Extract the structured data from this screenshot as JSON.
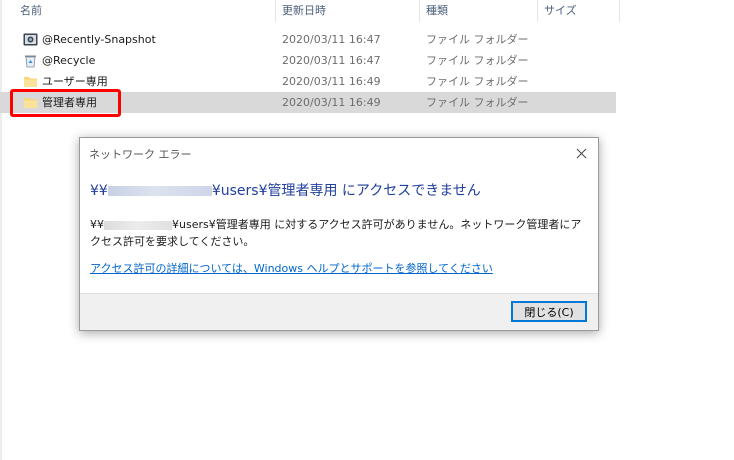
{
  "columns": {
    "name": "名前",
    "date": "更新日時",
    "type": "種類",
    "size": "サイズ"
  },
  "files": [
    {
      "name": "@Recently-Snapshot",
      "date": "2020/03/11 16:47",
      "type": "ファイル フォルダー",
      "icon": "snapshot-folder-icon"
    },
    {
      "name": "@Recycle",
      "date": "2020/03/11 16:47",
      "type": "ファイル フォルダー",
      "icon": "recycle-bin-icon"
    },
    {
      "name": "ユーザー専用",
      "date": "2020/03/11 16:49",
      "type": "ファイル フォルダー",
      "icon": "folder-icon"
    },
    {
      "name": "管理者専用",
      "date": "2020/03/11 16:49",
      "type": "ファイル フォルダー",
      "icon": "folder-icon",
      "selected": true
    }
  ],
  "dialog": {
    "title": "ネットワーク エラー",
    "heading_prefix": "¥¥",
    "heading_path": "¥users¥管理者専用 にアクセスできません",
    "message_prefix": "¥¥",
    "message_path": "¥users¥管理者専用 に対するアクセス許可がありません。ネットワーク管理者にアクセス許可を要求してください。",
    "link": "アクセス許可の詳細については、Windows ヘルプとサポートを参照してください",
    "close_button": "閉じる(C)",
    "accent_color": "#1f3f9e",
    "link_color": "#0066cc",
    "highlight_color": "#ff0000"
  }
}
